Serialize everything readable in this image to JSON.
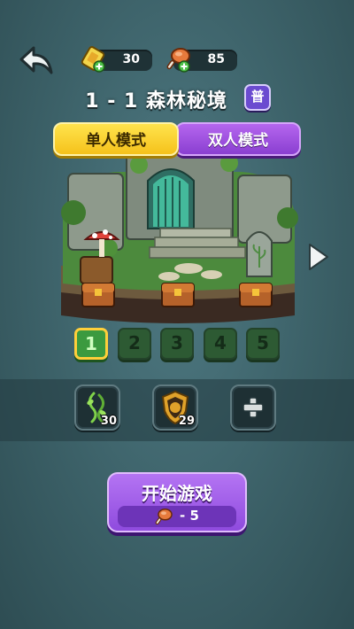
{
  "topbar": {
    "tickets": "30",
    "meat": "85"
  },
  "title": {
    "level": "1 - 1",
    "name": "森林秘境",
    "difficulty": "普"
  },
  "modes": {
    "single": "单人模式",
    "double": "双人模式"
  },
  "stages": [
    "1",
    "2",
    "3",
    "4",
    "5"
  ],
  "selected_stage": "1",
  "items": [
    {
      "icon": "vine-icon",
      "count": "30"
    },
    {
      "icon": "shield-icon",
      "count": "29"
    },
    {
      "icon": "plus-icon",
      "count": ""
    }
  ],
  "start": {
    "label": "开始游戏",
    "cost": "- 5"
  },
  "colors": {
    "background": "#3c6168",
    "selected_tab": "#f5c21b",
    "purple": "#8f4bde",
    "stage_selected": "#3b9a3f"
  }
}
